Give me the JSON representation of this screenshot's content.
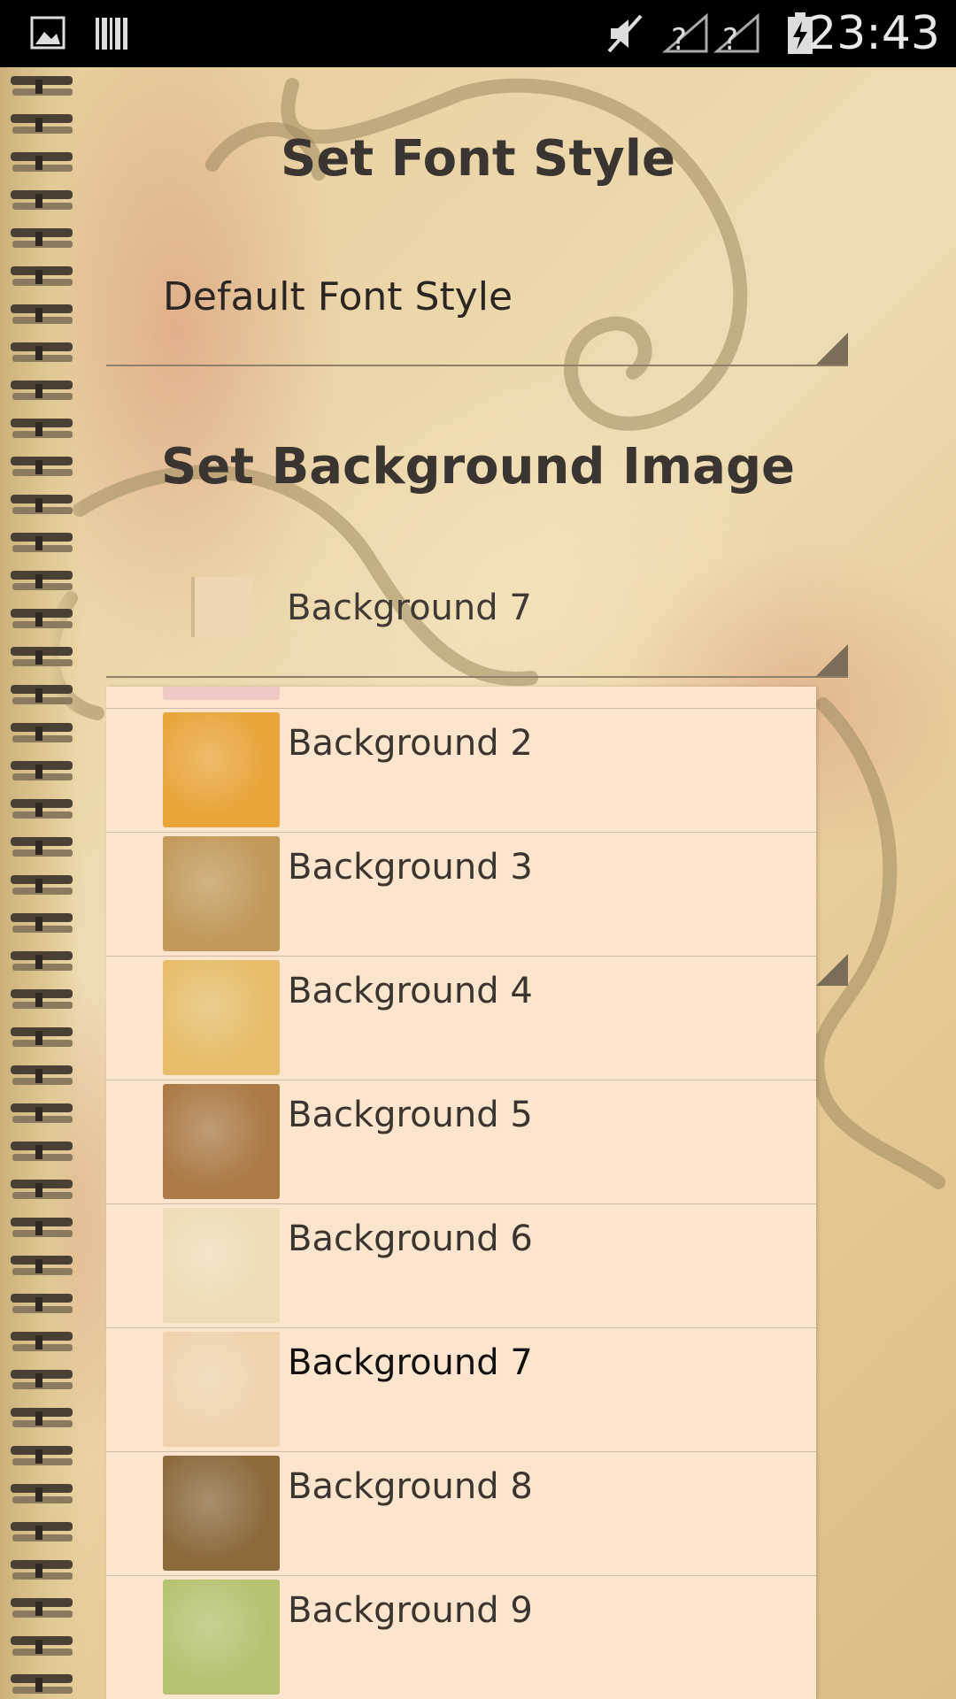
{
  "status_bar": {
    "time": "23:43",
    "icons": [
      "gallery-icon",
      "barcode-icon",
      "mute-icon",
      "signal-unknown-icon",
      "signal-unknown-icon",
      "battery-charging-icon"
    ]
  },
  "font_section": {
    "heading": "Set Font Style",
    "spinner_value": "Default Font Style"
  },
  "background_section": {
    "heading": "Set Background Image",
    "spinner_value": "Background 7"
  },
  "dropdown": {
    "selected": "Background 7",
    "items": [
      {
        "label": "Background 2",
        "color": "#e9a43a"
      },
      {
        "label": "Background 3",
        "color": "#c2995b"
      },
      {
        "label": "Background 4",
        "color": "#e6bd6a"
      },
      {
        "label": "Background 5",
        "color": "#ab7a46"
      },
      {
        "label": "Background 6",
        "color": "#efdcb6"
      },
      {
        "label": "Background 7",
        "color": "#efd3ad"
      },
      {
        "label": "Background 8",
        "color": "#8c6a3c"
      },
      {
        "label": "Background 9",
        "color": "#b6c271"
      }
    ]
  }
}
